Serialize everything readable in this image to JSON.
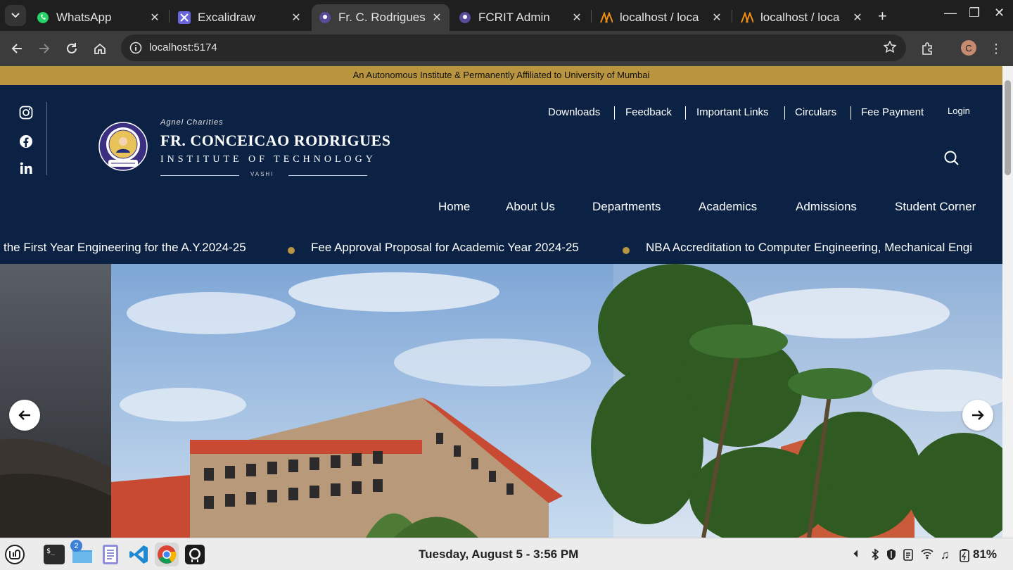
{
  "browser": {
    "tabs": [
      {
        "title": "WhatsApp",
        "icon": "whatsapp-icon",
        "active": false
      },
      {
        "title": "Excalidraw",
        "icon": "excalidraw-icon",
        "active": false
      },
      {
        "title": "Fr. C. Rodrigues",
        "icon": "fcrit-icon",
        "active": true
      },
      {
        "title": "FCRIT Admin",
        "icon": "fcrit-icon",
        "active": false
      },
      {
        "title": "localhost / loca",
        "icon": "phpmyadmin-icon",
        "active": false
      },
      {
        "title": "localhost / loca",
        "icon": "phpmyadmin-icon",
        "active": false
      }
    ],
    "url": "localhost:5174",
    "profile_initial": "C",
    "new_tab_label": "+"
  },
  "site": {
    "top_strip": "An Autonomous Institute & Permanently Affiliated to University of Mumbai",
    "brand": {
      "small": "Agnel Charities",
      "main": "FR. CONCEICAO RODRIGUES",
      "sub": "INSTITUTE OF TECHNOLOGY",
      "location": "VASHI"
    },
    "util_links": [
      "Downloads",
      "Feedback",
      "Important Links",
      "Circulars",
      "Fee Payment"
    ],
    "login": "Login",
    "nav": [
      "Home",
      "About Us",
      "Departments",
      "Academics",
      "Admissions",
      "Student Corner"
    ],
    "ticker": [
      "the First Year Engineering for the A.Y.2024-25",
      "Fee Approval Proposal for Academic Year 2024-25",
      "NBA Accreditation to Computer Engineering, Mechanical Engi"
    ],
    "colors": {
      "navy": "#0b2244",
      "gold": "#b9953f"
    }
  },
  "taskbar": {
    "clock": "Tuesday, August   5 -   3:56 PM",
    "battery": "81%",
    "files_badge": "2"
  }
}
